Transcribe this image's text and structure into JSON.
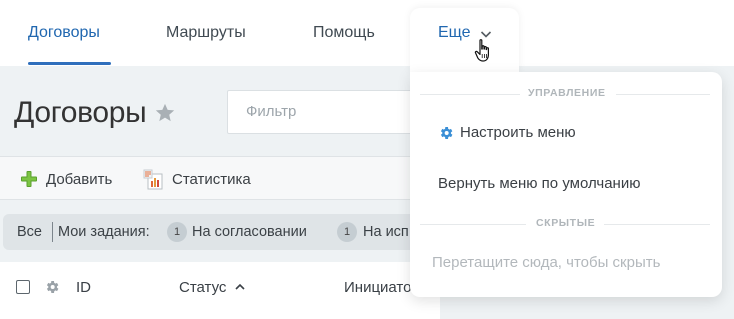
{
  "nav": {
    "tabs": [
      {
        "label": "Договоры",
        "active": true
      },
      {
        "label": "Маршруты",
        "active": false
      },
      {
        "label": "Помощь",
        "active": false
      },
      {
        "label": "Еще",
        "active": false
      }
    ]
  },
  "page": {
    "title": "Договоры",
    "filter_placeholder": "Фильтр"
  },
  "toolbar": {
    "add_label": "Добавить",
    "stats_label": "Статистика"
  },
  "filters": {
    "all_label": "Все",
    "my_tasks_label": "Мои задания:",
    "items": [
      {
        "count": "1",
        "label": "На согласовании"
      },
      {
        "count": "1",
        "label": "На исп"
      }
    ]
  },
  "table": {
    "columns": [
      "ID",
      "Статус",
      "Инициато"
    ],
    "sort_indicator": "^"
  },
  "menu": {
    "section_manage": "УПРАВЛЕНИЕ",
    "configure_label": "Настроить меню",
    "reset_label": "Вернуть меню по умолчанию",
    "section_hidden": "СКРЫТЫЕ",
    "drag_hint": "Перетащите сюда, чтобы скрыть"
  },
  "colors": {
    "accent": "#2067b0",
    "underline": "#2f6fbc",
    "gear_icon": "#3a8fd6",
    "add_icon": "#5aa02c"
  },
  "icons": {
    "star": "star-icon",
    "add": "plus-icon",
    "stats": "statistics-icon",
    "gear": "gear-icon",
    "chevron": "chevron-down-icon",
    "cursor": "hand-cursor-icon"
  }
}
